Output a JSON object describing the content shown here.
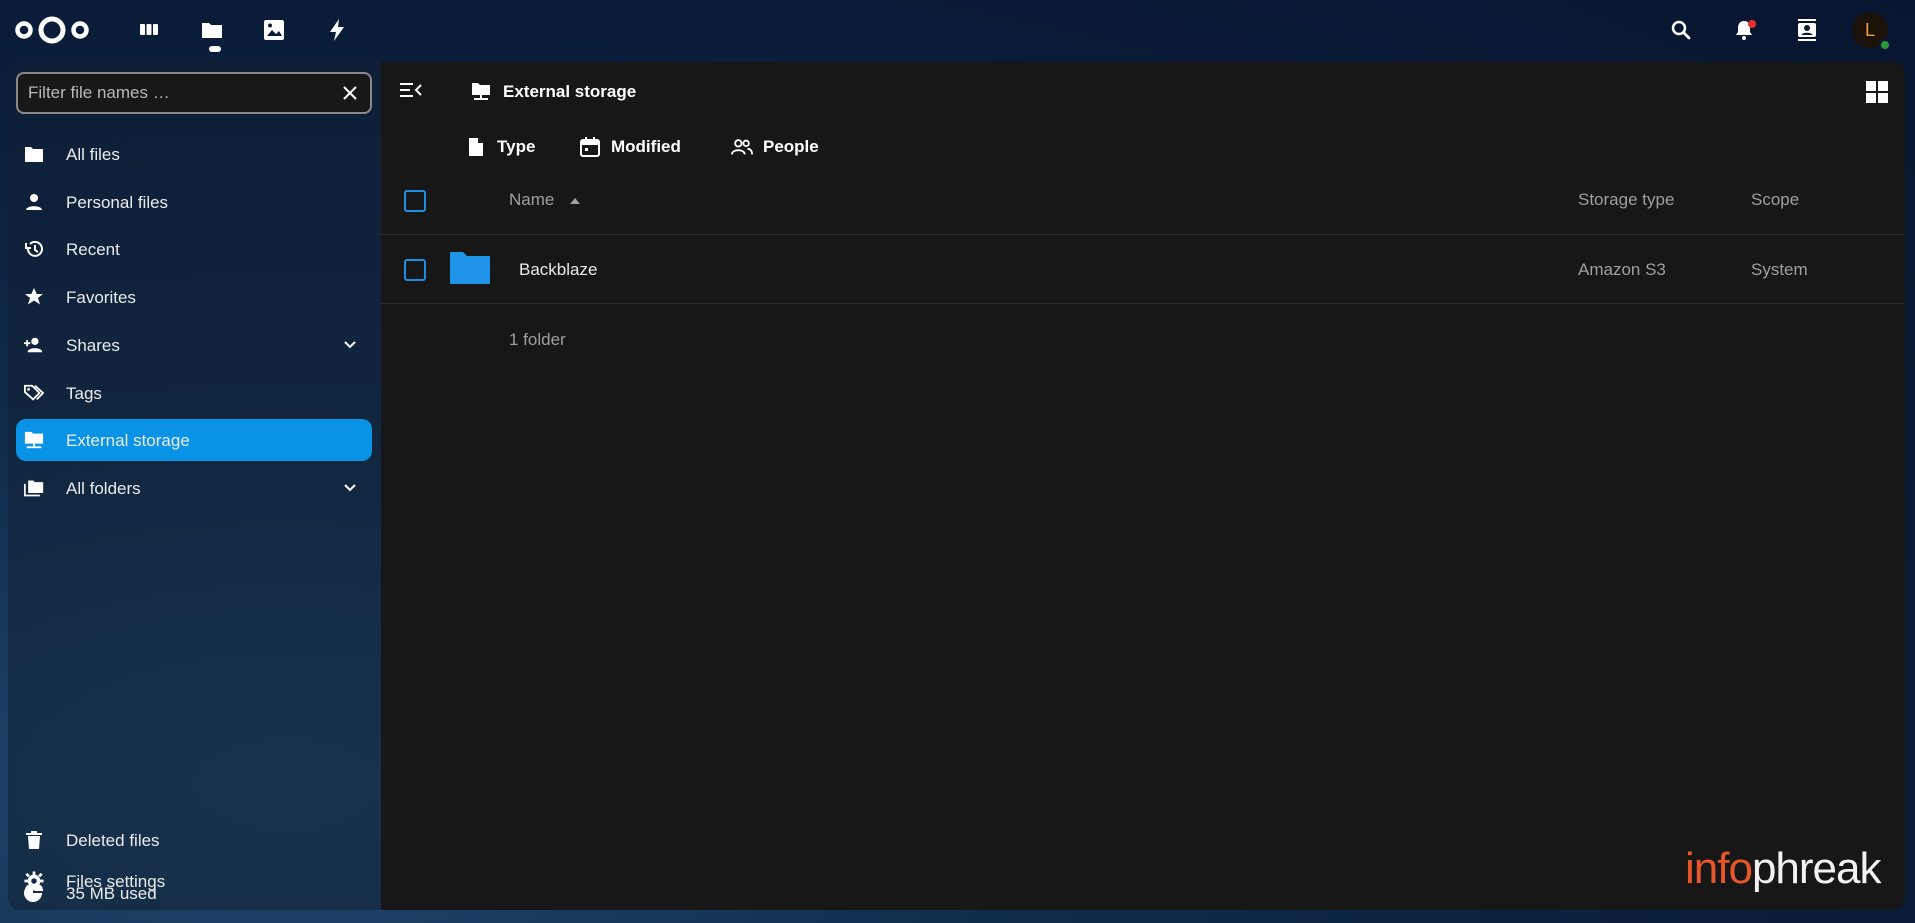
{
  "header": {
    "apps": [
      {
        "name": "dashboard",
        "icon": "dashboard-icon"
      },
      {
        "name": "files",
        "icon": "folder-icon",
        "active": true
      },
      {
        "name": "photos",
        "icon": "image-icon"
      },
      {
        "name": "activity",
        "icon": "lightning-icon"
      }
    ],
    "right_icons": [
      "search-icon",
      "bell-icon",
      "contacts-icon"
    ],
    "avatar_letter": "L"
  },
  "sidebar": {
    "filter_placeholder": "Filter file names …",
    "items": [
      {
        "label": "All files",
        "icon": "folder-icon"
      },
      {
        "label": "Personal files",
        "icon": "person-icon"
      },
      {
        "label": "Recent",
        "icon": "history-icon"
      },
      {
        "label": "Favorites",
        "icon": "star-icon"
      },
      {
        "label": "Shares",
        "icon": "share-icon",
        "expandable": true
      },
      {
        "label": "Tags",
        "icon": "tag-icon"
      },
      {
        "label": "External storage",
        "icon": "external-storage-icon",
        "active": true
      },
      {
        "label": "All folders",
        "icon": "folders-icon",
        "expandable": true
      }
    ],
    "footer": [
      {
        "label": "Deleted files",
        "icon": "trash-icon"
      },
      {
        "label": "35 MB used",
        "icon": "pie-chart-icon"
      },
      {
        "label": "Files settings",
        "icon": "gear-icon"
      }
    ]
  },
  "main": {
    "breadcrumb": "External storage",
    "filters": [
      {
        "label": "Type",
        "icon": "file-icon"
      },
      {
        "label": "Modified",
        "icon": "calendar-icon"
      },
      {
        "label": "People",
        "icon": "people-icon"
      }
    ],
    "columns": {
      "name": "Name",
      "storage_type": "Storage type",
      "scope": "Scope"
    },
    "rows": [
      {
        "name": "Backblaze",
        "storage_type": "Amazon S3",
        "scope": "System"
      }
    ],
    "summary": "1 folder"
  },
  "watermark": {
    "part1": "info",
    "part2": "phreak"
  },
  "colors": {
    "accent": "#0893e6",
    "checkbox": "#1c8ee4",
    "watermark_orange": "#e8562a"
  }
}
